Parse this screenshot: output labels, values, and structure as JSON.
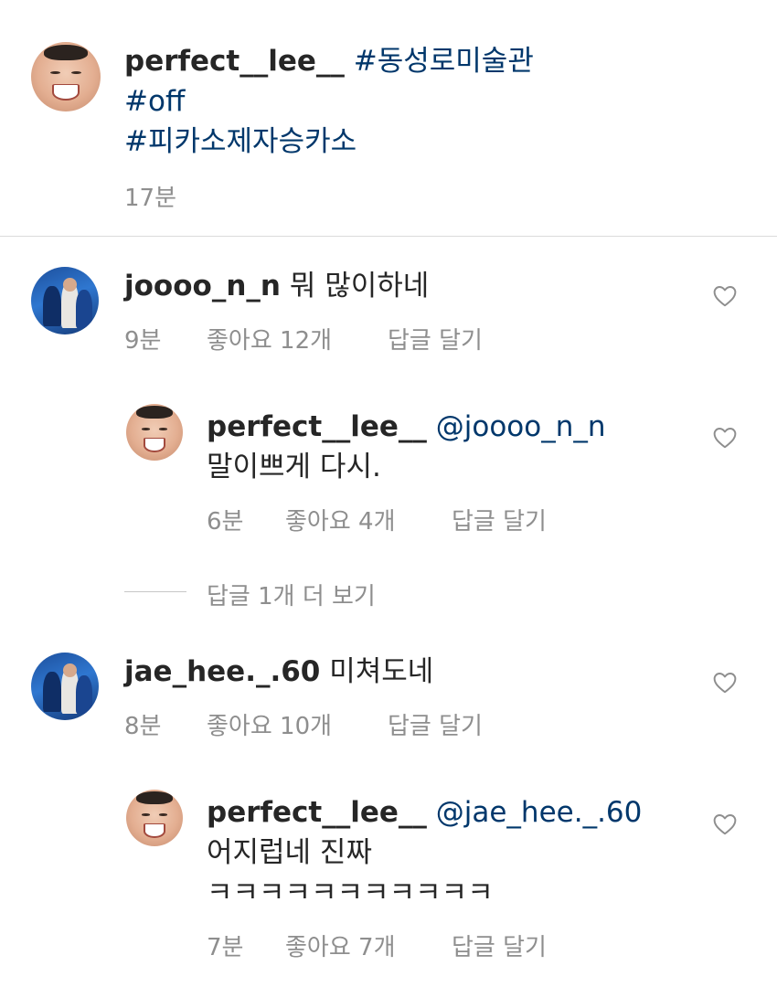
{
  "caption": {
    "username": "perfect__lee__",
    "tags": [
      "#동성로미술관",
      "#off",
      "#피카소제자승카소"
    ],
    "time": "17분"
  },
  "comments": [
    {
      "username": "joooo_n_n",
      "text": "뭐 많이하네",
      "time": "9분",
      "likes": "좋아요 12개",
      "reply_label": "답글 달기",
      "replies": [
        {
          "username": "perfect__lee__",
          "mention": "@joooo_n_n",
          "lines": [
            "말이쁘게 다시."
          ],
          "time": "6분",
          "likes": "좋아요 4개",
          "reply_label": "답글 달기"
        }
      ],
      "view_more": "답글 1개 더 보기"
    },
    {
      "username": "jae_hee._.60",
      "text": "미쳐도네",
      "time": "8분",
      "likes": "좋아요 10개",
      "reply_label": "답글 달기",
      "replies": [
        {
          "username": "perfect__lee__",
          "mention": "@jae_hee._.60",
          "lines": [
            "어지럽네 진짜",
            "ㅋㅋㅋㅋㅋㅋㅋㅋㅋㅋㅋ"
          ],
          "time": "7분",
          "likes": "좋아요 7개",
          "reply_label": "답글 달기"
        }
      ]
    }
  ],
  "icons": {
    "heart": "heart-outline-icon"
  },
  "colors": {
    "text": "#262626",
    "hashtag": "#00376b",
    "meta": "#8e8e8e",
    "divider": "#dbdbdb"
  }
}
